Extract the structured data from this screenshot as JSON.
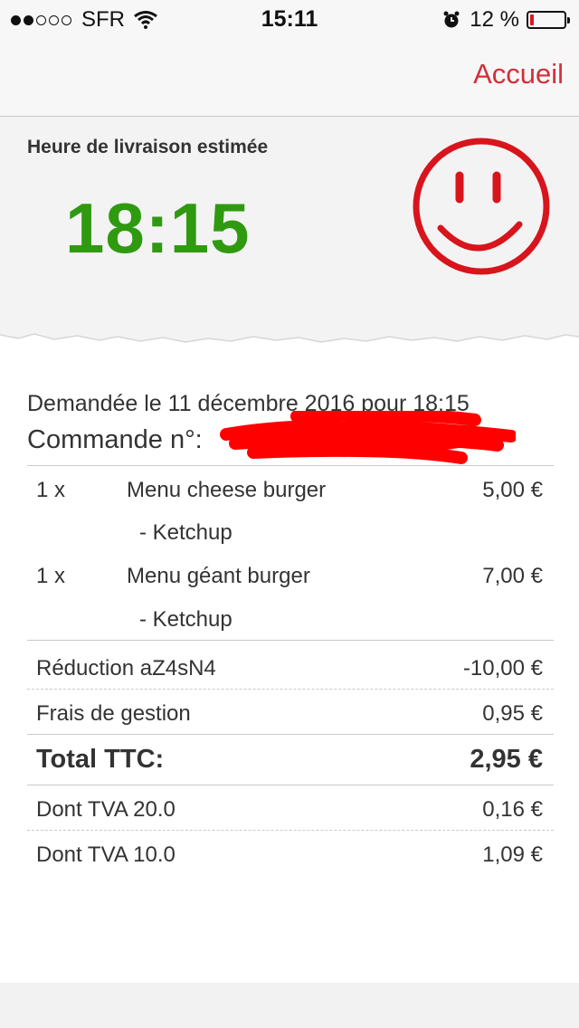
{
  "status_bar": {
    "carrier": "SFR",
    "time": "15:11",
    "battery_text": "12 %",
    "battery_level": 0.12,
    "signal_bars": 2,
    "icons": [
      "signal-dots-icon",
      "wifi-icon",
      "alarm-icon",
      "battery-icon"
    ]
  },
  "nav": {
    "home_label": "Accueil"
  },
  "delivery": {
    "label": "Heure de livraison estimée",
    "time": "18:15",
    "icon": "smiley-icon"
  },
  "receipt": {
    "requested": "Demandée le 11 décembre 2016 pour 18:15",
    "order_label": "Commande n°:",
    "order_number_redacted": true,
    "items": [
      {
        "qty": "1 x",
        "name": "Menu cheese burger",
        "price": "5,00 €",
        "option": "- Ketchup"
      },
      {
        "qty": "1 x",
        "name": "Menu géant burger",
        "price": "7,00 €",
        "option": "- Ketchup"
      }
    ],
    "discount": {
      "label": "Réduction aZ4sN4",
      "value": "-10,00 €"
    },
    "fees": {
      "label": "Frais de gestion",
      "value": "0,95 €"
    },
    "total": {
      "label": "Total TTC:",
      "value": "2,95 €"
    },
    "vat": [
      {
        "label": "Dont TVA 20.0",
        "value": "0,16 €"
      },
      {
        "label": "Dont TVA 10.0",
        "value": "1,09 €"
      }
    ]
  },
  "colors": {
    "accent": "#d0303a",
    "eta_green": "#2f9a10",
    "smiley_red": "#d8141c",
    "redaction_red": "#ff0000"
  }
}
